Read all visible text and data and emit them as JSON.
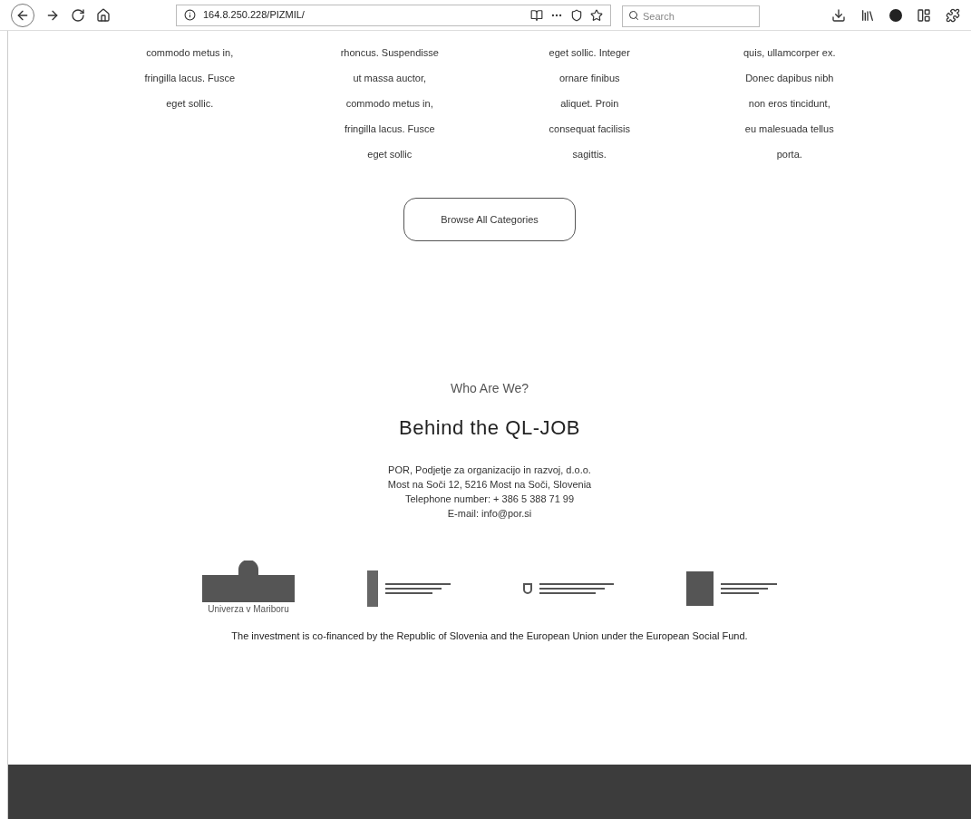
{
  "browser": {
    "url": "164.8.250.228/PIZMIL/",
    "search_placeholder": "Search"
  },
  "columns": [
    {
      "lines": [
        "commodo metus in,",
        "fringilla lacus. Fusce",
        "eget sollic."
      ]
    },
    {
      "lines": [
        "rhoncus. Suspendisse",
        "ut massa auctor,",
        "commodo metus in,",
        "fringilla lacus. Fusce",
        "eget sollic"
      ]
    },
    {
      "lines": [
        "eget sollic. Integer",
        "ornare finibus",
        "aliquet. Proin",
        "consequat facilisis",
        "sagittis."
      ]
    },
    {
      "lines": [
        "quis, ullamcorper ex.",
        "Donec dapibus nibh",
        "non eros tincidunt,",
        "eu malesuada tellus",
        "porta."
      ]
    }
  ],
  "browse_button": "Browse All Categories",
  "about": {
    "eyebrow": "Who Are We?",
    "title": "Behind the QL-JOB",
    "contact": [
      "POR, Podjetje za organizacijo in razvoj, d.o.o.",
      "Most na Soči 12, 5216 Most na Soči, Slovenia",
      "Telephone number: + 386 5 388 71 99",
      "E-mail: info@por.si"
    ]
  },
  "logos": [
    {
      "kind": "university",
      "caption": "Univerza v Mariboru"
    },
    {
      "kind": "pillar"
    },
    {
      "kind": "crest"
    },
    {
      "kind": "eu"
    }
  ],
  "funding_note": "The investment is co-financed by the Republic of Slovenia and the European Union under the European Social Fund."
}
